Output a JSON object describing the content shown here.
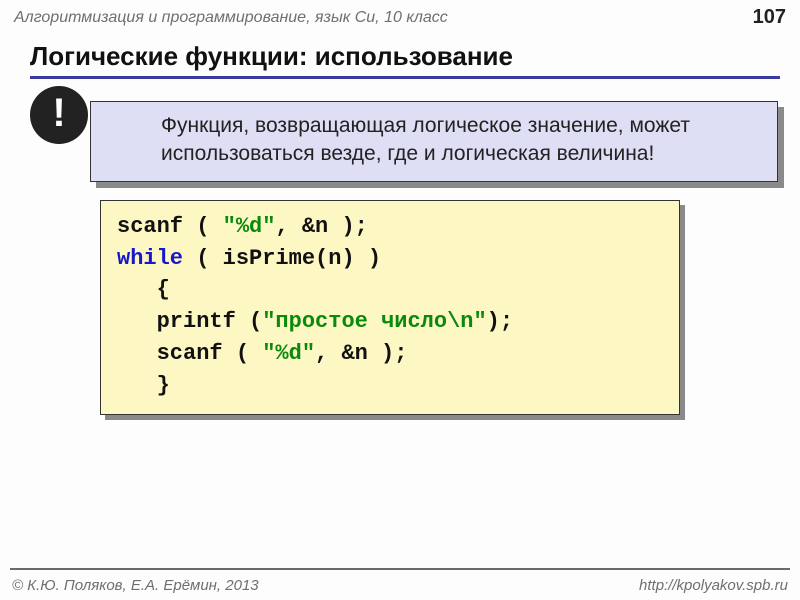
{
  "header": {
    "course": "Алгоритмизация и программирование, язык Си, 10 класс",
    "page": "107"
  },
  "title": "Логические функции: использование",
  "badge": "!",
  "callout": "Функция, возвращающая логическое значение, может использоваться везде, где и логическая величина!",
  "code": {
    "l1a": "scanf ( ",
    "l1b": "\"%d\"",
    "l1c": ", &n );",
    "l2a": "while",
    "l2b": " ( isPrime(n) )",
    "l3": "   {",
    "l4a": "   printf (",
    "l4b": "\"простое число\\n\"",
    "l4c": ");",
    "l5a": "   scanf ( ",
    "l5b": "\"%d\"",
    "l5c": ", &n );",
    "l6": "   }"
  },
  "footer": {
    "left": "© К.Ю. Поляков, Е.А. Ерёмин, 2013",
    "right": "http://kpolyakov.spb.ru"
  }
}
